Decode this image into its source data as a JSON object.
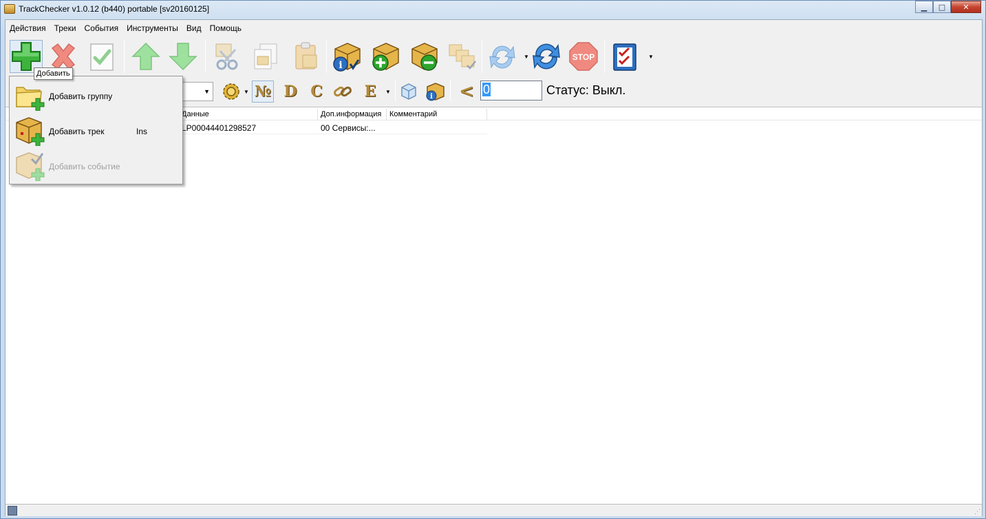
{
  "window": {
    "title": "TrackChecker v1.0.12 (b440)  portable [sv20160125]",
    "controls": [
      "minimize-icon",
      "maximize-icon",
      "close-icon"
    ]
  },
  "menubar": {
    "items": [
      "Действия",
      "Треки",
      "События",
      "Инструменты",
      "Вид",
      "Помощь"
    ]
  },
  "toolbar": {
    "buttons": [
      {
        "icon": "add-plus-icon",
        "state": "pressed"
      },
      {
        "icon": "delete-x-icon",
        "state": "disabled"
      },
      {
        "icon": "check-document-icon",
        "state": "disabled"
      },
      {
        "icon": "arrow-up-icon",
        "state": "disabled"
      },
      {
        "icon": "arrow-down-icon",
        "state": "disabled"
      },
      {
        "icon": "cut-scissors-icon",
        "state": "disabled"
      },
      {
        "icon": "copy-icon",
        "state": "disabled"
      },
      {
        "icon": "paste-clipboard-icon",
        "state": "disabled"
      },
      {
        "icon": "package-info-icon",
        "state": "enabled"
      },
      {
        "icon": "package-add-icon",
        "state": "enabled"
      },
      {
        "icon": "package-remove-icon",
        "state": "enabled"
      },
      {
        "icon": "packages-check-icon",
        "state": "disabled"
      },
      {
        "icon": "refresh-icon",
        "state": "enabled"
      },
      {
        "icon": "refresh-all-icon",
        "state": "enabled"
      },
      {
        "icon": "stop-icon",
        "state": "disabled"
      },
      {
        "icon": "checklist-icon",
        "state": "enabled"
      }
    ],
    "stop_label": "STOP"
  },
  "toolbar2": {
    "filter_letters": [
      "№",
      "D",
      "C",
      "E"
    ],
    "less_than": "<",
    "counter_value": "0",
    "status_text": "Статус: Выкл."
  },
  "table": {
    "columns": [
      "Данные",
      "Доп.информация",
      "Комментарий"
    ],
    "rows": [
      {
        "data": "LP00044401298527",
        "extra": "00 Сервисы:...",
        "comment": ""
      }
    ]
  },
  "tooltip": {
    "text": "Добавить"
  },
  "popup_menu": {
    "items": [
      {
        "label": "Добавить группу",
        "shortcut": "",
        "icon": "folder-add-icon",
        "enabled": true
      },
      {
        "label": "Добавить трек",
        "shortcut": "Ins",
        "icon": "package-add-icon",
        "enabled": true
      },
      {
        "label": "Добавить событие",
        "shortcut": "",
        "icon": "event-add-icon",
        "enabled": false
      }
    ]
  },
  "colors": {
    "accent_green": "#3cb43c",
    "window_frame": "#c9dcef",
    "close_red": "#c64530",
    "selection_blue": "#3399ff"
  }
}
